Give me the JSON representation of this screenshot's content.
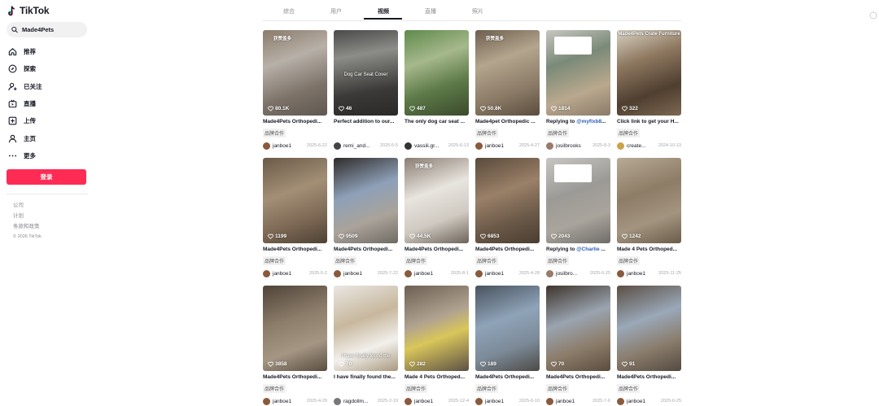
{
  "app": {
    "logo_text": "TikTok"
  },
  "search": {
    "value": "Made4Pets"
  },
  "nav": [
    {
      "label": "推荐",
      "icon": "home-icon"
    },
    {
      "label": "探索",
      "icon": "compass-icon"
    },
    {
      "label": "已关注",
      "icon": "following-icon"
    },
    {
      "label": "直播",
      "icon": "live-icon"
    },
    {
      "label": "上传",
      "icon": "upload-icon"
    },
    {
      "label": "主页",
      "icon": "profile-icon"
    },
    {
      "label": "更多",
      "icon": "more-icon"
    }
  ],
  "login_label": "登录",
  "footer": {
    "links": [
      "公司",
      "计划",
      "条款和政策"
    ],
    "copyright": "© 2026 TikTok"
  },
  "tabs": [
    {
      "label": "综合",
      "active": false
    },
    {
      "label": "用户",
      "active": false
    },
    {
      "label": "视频",
      "active": true
    },
    {
      "label": "直播",
      "active": false
    },
    {
      "label": "照片",
      "active": false
    }
  ],
  "colors": {
    "accent": "#fe2c55",
    "mention": "#2b5db9"
  },
  "videos": [
    {
      "likes": "80.1K",
      "tag": "获赞盖多",
      "desc": "Made4Pets Orthopedi...",
      "badge": "品牌合作",
      "author": "janboe1",
      "date": "2025-6-22",
      "bg": "linear-gradient(160deg,#8b7b6a 0%,#b7b0a8 35%,#7c7268 70%,#5f5850 100%)",
      "avatar": "#8a5a3c"
    },
    {
      "likes": "46",
      "overlay": "Dog Car Seat Cover",
      "desc": "Perfect addition to our...",
      "author": "remi_and...",
      "date": "2025-5-5",
      "bg": "linear-gradient(170deg,#4a4a4a 0%,#8c8c88 30%,#3b3a38 70%,#2a2927 100%)",
      "avatar": "#444444"
    },
    {
      "likes": "487",
      "desc": "The only dog car seat ...",
      "author": "vassili.gr...",
      "date": "2025-6-13",
      "bg": "linear-gradient(160deg,#5f8a4c 0%,#a6b88c 35%,#5d7a48 65%,#3b4a2c 100%)",
      "avatar": "#333333"
    },
    {
      "likes": "50.8K",
      "tag": "获赞盖多",
      "desc": "Made4pet Orthopedic ...",
      "badge": "品牌合作",
      "author": "janboe1",
      "date": "2025-4-27",
      "bg": "linear-gradient(160deg,#6e5e4e 0%,#b4a58e 35%,#8a7a66 70%,#5b4d3e 100%)",
      "avatar": "#8a5a3c"
    },
    {
      "likes": "1814",
      "overlay_box": true,
      "desc_pre": "Replying to ",
      "desc_mention": "@myfixb8",
      "desc_post": "...",
      "badge": "品牌合作",
      "author": "josilbrooks",
      "date": "2025-8-3",
      "bg": "linear-gradient(160deg,#c9c6c0 0%,#7a8a78 35%,#b9a88e 70%,#8a7b68 100%)",
      "avatar": "#9a7a6a"
    },
    {
      "likes": "322",
      "tv_text": "Made4Pets Crate Furniture",
      "desc": "Click link to get your H...",
      "badge": "品牌合作",
      "author": "create...",
      "date": "2024-10-13",
      "bg": "linear-gradient(160deg,#d9d2c4 0%,#8e7860 35%,#4f3f30 70%,#7d6752 100%)",
      "avatar": "#c9a44a"
    },
    {
      "likes": "1199",
      "desc": "Made4Pets Orthopedi...",
      "badge": "品牌合作",
      "author": "janboe1",
      "date": "2025-5-2",
      "bg": "linear-gradient(160deg,#6b5a48 0%,#a38f76 40%,#7f6a56 70%,#4e4134 100%)",
      "avatar": "#8a5a3c"
    },
    {
      "likes": "9509",
      "desc": "Made4Pets Orthopedi...",
      "badge": "品牌合作",
      "author": "janboe1",
      "date": "2025-7-22",
      "bg": "linear-gradient(160deg,#2f2c2a 0%,#8ea0b8 40%,#a9a39a 70%,#6f6a63 100%)",
      "avatar": "#8a5a3c"
    },
    {
      "likes": "44.5K",
      "tag": "获赞盖多",
      "desc": "Made4Pets Orthopedi...",
      "badge": "品牌合作",
      "author": "janboe1",
      "date": "2025-8-1",
      "bg": "linear-gradient(160deg,#8a7e72 0%,#e8e4de 40%,#cfc9c1 70%,#6d645a 100%)",
      "avatar": "#8a5a3c"
    },
    {
      "likes": "6853",
      "desc": "Made4Pets Orthopedi...",
      "badge": "品牌合作",
      "author": "janboe1",
      "date": "2025-4-28",
      "bg": "linear-gradient(160deg,#5a4a3c 0%,#9a8068 40%,#6c5a49 70%,#4a3d31 100%)",
      "avatar": "#8a5a3c"
    },
    {
      "likes": "2043",
      "overlay_box": true,
      "desc_pre": "Replying to ",
      "desc_mention": "@Charlie",
      "desc_post": " ...",
      "badge": "品牌合作",
      "author": "josilbro...",
      "date": "2025-6-25",
      "bg": "linear-gradient(160deg,#c8c6c2 0%,#9c9a96 40%,#a9a49c 70%,#6f6c68 100%)",
      "avatar": "#9a7a6a"
    },
    {
      "likes": "1242",
      "desc": "Made 4 Pets Orthoped...",
      "badge": "品牌合作",
      "author": "janboe1",
      "date": "2025-11-25",
      "bg": "linear-gradient(160deg,#b8aa96 0%,#8d7c66 40%,#a39480 70%,#6b5c4a 100%)",
      "avatar": "#8a5a3c"
    },
    {
      "likes": "3858",
      "desc": "Made4Pets Orthopedi...",
      "badge": "品牌合作",
      "author": "janboe1",
      "date": "2025-4-29",
      "bg": "linear-gradient(160deg,#4f4438 0%,#8c7c6a 40%,#a59684 70%,#5a4d40 100%)",
      "avatar": "#8a5a3c"
    },
    {
      "likes": "70",
      "overlay": "I have finally found the",
      "desc": "I have finally found the...",
      "author": "ragdollm...",
      "date": "2025-2-19",
      "bg": "linear-gradient(160deg,#e9e7e3 0%,#c7b79d 40%,#f2f0ec 70%,#a8987e 100%)",
      "avatar": "#777777"
    },
    {
      "likes": "282",
      "desc": "Made 4 Pets Orthoped...",
      "badge": "品牌合作",
      "author": "janboe1",
      "date": "2025-12-4",
      "bg": "linear-gradient(160deg,#6c5f52 0%,#b0a290 40%,#d9c65a 60%,#5d5146 100%)",
      "avatar": "#8a5a3c"
    },
    {
      "likes": "189",
      "desc": "Made4Pets Orthopedi...",
      "badge": "品牌合作",
      "author": "janboe1",
      "date": "2025-6-10",
      "bg": "linear-gradient(160deg,#48525e 0%,#8fa3b8 40%,#7c8a98 70%,#4d4a46 100%)",
      "avatar": "#8a5a3c"
    },
    {
      "likes": "70",
      "desc": "Made4Pets Orthopedi...",
      "badge": "品牌合作",
      "author": "janboe1",
      "date": "2025-7-6",
      "bg": "linear-gradient(160deg,#3e342c 0%,#9aa4b0 40%,#8c7c6a 70%,#5a4c3e 100%)",
      "avatar": "#8a5a3c"
    },
    {
      "likes": "91",
      "desc": "Made4Pets Orthopedi...",
      "badge": "品牌合作",
      "author": "janboe1",
      "date": "2025-6-25",
      "bg": "linear-gradient(160deg,#5a4e44 0%,#9aa8b8 40%,#8a7c6c 70%,#544a40 100%)",
      "avatar": "#8a5a3c"
    }
  ]
}
